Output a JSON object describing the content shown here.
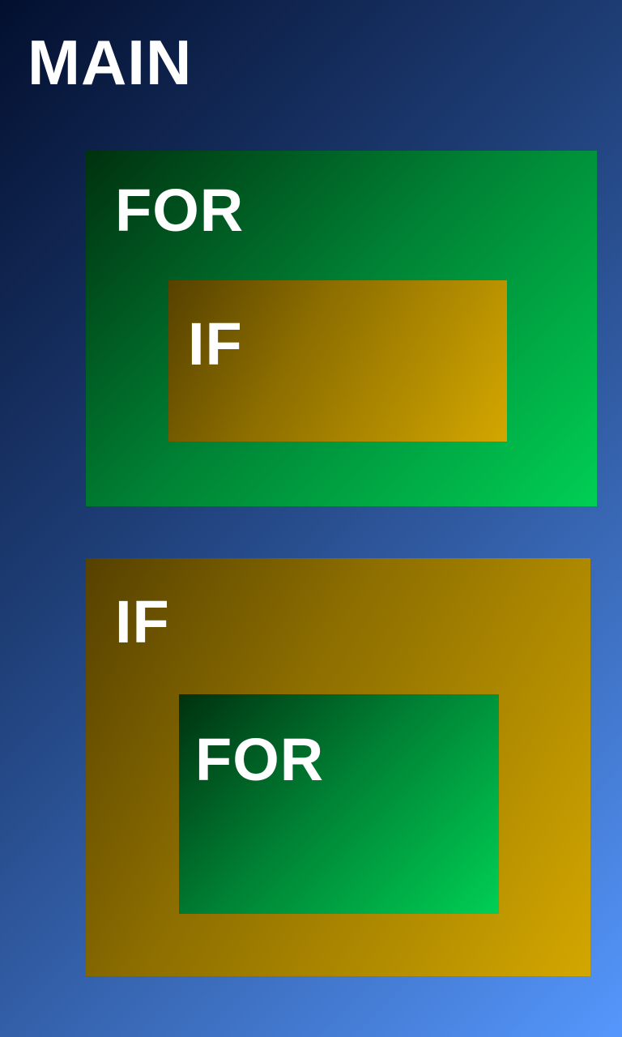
{
  "main": {
    "label": "MAIN",
    "children": [
      {
        "type": "FOR",
        "label": "FOR",
        "children": [
          {
            "type": "IF",
            "label": "IF"
          }
        ]
      },
      {
        "type": "IF",
        "label": "IF",
        "children": [
          {
            "type": "FOR",
            "label": "FOR"
          }
        ]
      }
    ]
  },
  "colors": {
    "main_background": "#1f3f78",
    "for_block": "#007f33",
    "if_block": "#a88300",
    "text": "#ffffff"
  }
}
